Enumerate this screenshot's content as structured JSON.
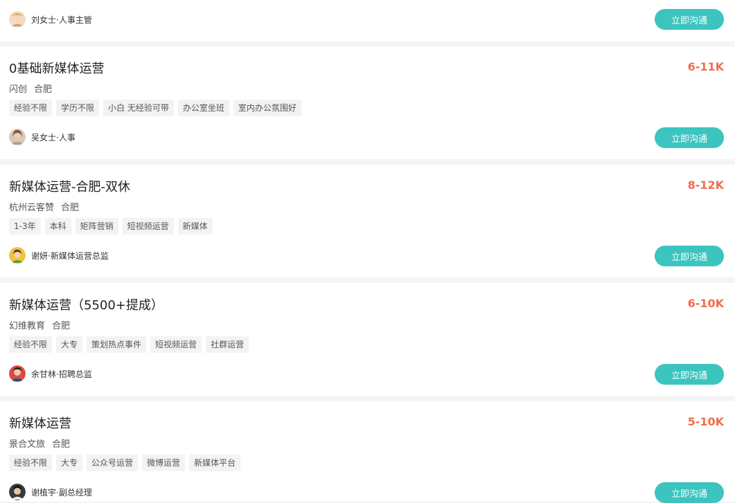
{
  "chat_button_label": "立即沟通",
  "colors": {
    "salary": "#f26d4c",
    "button": "#3cc4bf",
    "tag_bg": "#f3f3f3"
  },
  "top_card": {
    "recruiter": {
      "name": "刘女士·人事主管",
      "avatar_icon": "recruiter-avatar-icon"
    }
  },
  "jobs": [
    {
      "title": "0基础新媒体运营",
      "salary": "6-11K",
      "company": "闪创",
      "city": "合肥",
      "tags": [
        "经验不限",
        "学历不限",
        "小白 无经验可带",
        "办公室坐班",
        "室内办公氛围好"
      ],
      "recruiter": {
        "name": "吴女士·人事"
      }
    },
    {
      "title": "新媒体运营-合肥-双休",
      "salary": "8-12K",
      "company": "杭州云客赞",
      "city": "合肥",
      "tags": [
        "1-3年",
        "本科",
        "矩阵营销",
        "短视频运营",
        "新媒体"
      ],
      "recruiter": {
        "name": "谢妍·新媒体运营总监"
      }
    },
    {
      "title": "新媒体运营（5500+提成）",
      "salary": "6-10K",
      "company": "幻维教育",
      "city": "合肥",
      "tags": [
        "经验不限",
        "大专",
        "策划热点事件",
        "短视频运营",
        "社群运营"
      ],
      "recruiter": {
        "name": "余甘林·招聘总监"
      }
    },
    {
      "title": "新媒体运营",
      "salary": "5-10K",
      "company": "景合文旅",
      "city": "合肥",
      "tags": [
        "经验不限",
        "大专",
        "公众号运营",
        "微博运营",
        "新媒体平台"
      ],
      "recruiter": {
        "name": "谢植宇·副总经理"
      }
    }
  ]
}
